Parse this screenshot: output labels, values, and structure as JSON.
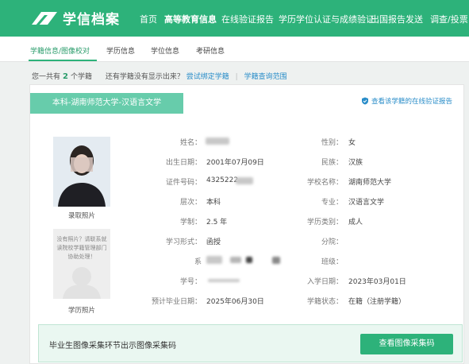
{
  "header": {
    "logo_text": "学信档案",
    "nav": [
      "首页",
      "高等教育信息",
      "在线验证报告",
      "学历学位认证与成绩验证",
      "出国报告发送",
      "调查/投票"
    ],
    "active_index": 1
  },
  "subnav": {
    "items": [
      "学籍信息/图像校对",
      "学历信息",
      "学位信息",
      "考研信息"
    ],
    "active_index": 0
  },
  "summary": {
    "prefix": "您一共有",
    "count": "2",
    "suffix": "个学籍",
    "question": "还有学籍没有显示出来？",
    "bind_link": "尝试绑定学籍",
    "separator": "|",
    "scope_link": "学籍查询范围"
  },
  "card": {
    "ribbon": "本科-湖南师范大学-汉语言文学",
    "verify_link": "查看该学籍的在线验证报告",
    "photo_label": "录取照片",
    "photo2_text": "没有照片？请联系就读院校学籍管理部门协助处理！",
    "photo2_label": "学历照片",
    "fields": {
      "name_label": "姓名：",
      "gender_label": "性别：",
      "gender": "女",
      "dob_label": "出生日期：",
      "dob": "2001年07月09日",
      "ethnicity_label": "民族：",
      "ethnicity": "汉族",
      "id_label": "证件号码：",
      "id": "4325222",
      "school_label": "学校名称：",
      "school": "湖南师范大学",
      "level_label": "层次：",
      "level": "本科",
      "major_label": "专业：",
      "major": "汉语言文学",
      "duration_label": "学制：",
      "duration": "2.5 年",
      "category_label": "学历类别：",
      "category": "成人",
      "mode_label": "学习形式：",
      "mode": "函授",
      "branch_label": "分院：",
      "dept_label": "系",
      "class_label": "班级：",
      "student_no_label": "学号：",
      "enroll_label": "入学日期：",
      "enroll": "2023年03月01日",
      "grad_label": "预计毕业日期：",
      "grad": "2025年06月30日",
      "status_label": "学籍状态：",
      "status": "在籍（注册学籍）"
    }
  },
  "bottom": {
    "text": "毕业生图像采集环节出示图像采集码",
    "button": "查看图像采集码"
  },
  "colors": {
    "brand": "#2db27a",
    "ribbon": "#57c7a3",
    "link": "#2a8dc9"
  },
  "icons": [
    "logo-book-icon",
    "shield-icon"
  ]
}
